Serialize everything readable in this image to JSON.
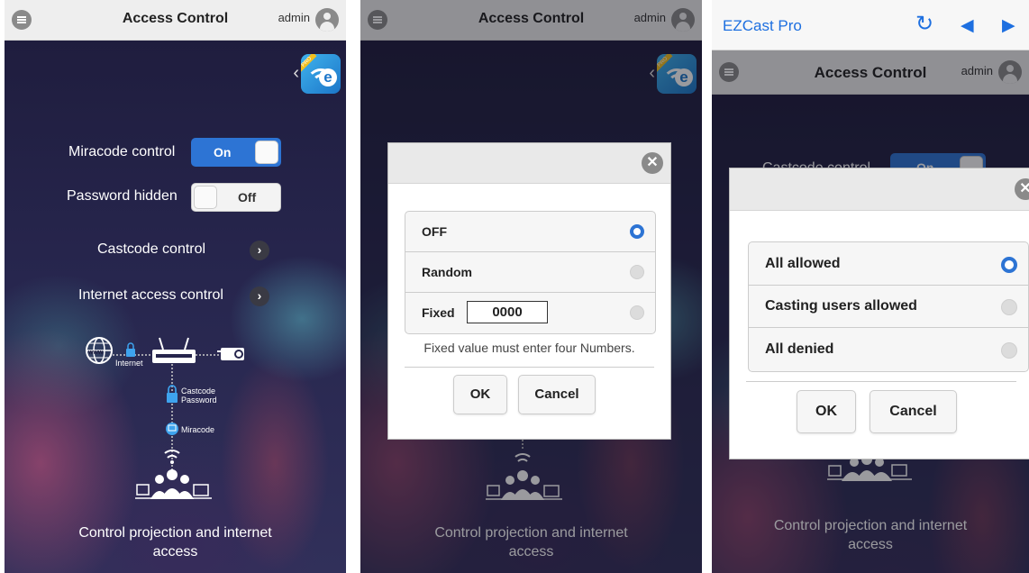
{
  "panel1": {
    "header": {
      "title": "Access Control",
      "user": "admin"
    },
    "miracode": {
      "label": "Miracode control",
      "state": "On"
    },
    "password": {
      "label": "Password hidden",
      "state": "Off"
    },
    "castcode": {
      "label": "Castcode control"
    },
    "internet": {
      "label": "Internet access control"
    },
    "diagram": {
      "www": "www",
      "internet": "Internet",
      "castcode": "Castcode",
      "password": "Password",
      "miracode": "Miracode"
    },
    "caption_line1": "Control projection and internet",
    "caption_line2": "access"
  },
  "panel2": {
    "header": {
      "title": "Access Control",
      "user": "admin"
    },
    "dialog": {
      "options": [
        {
          "label": "OFF",
          "selected": true
        },
        {
          "label": "Random",
          "selected": false
        },
        {
          "label": "Fixed",
          "selected": false
        }
      ],
      "fixed_value": "0000",
      "hint": "Fixed value must enter four Numbers.",
      "ok": "OK",
      "cancel": "Cancel"
    },
    "caption_line1": "Control projection and internet",
    "caption_line2": "access"
  },
  "panel3": {
    "browser": {
      "app_name": "EZCast Pro"
    },
    "header": {
      "title": "Access Control",
      "user": "admin"
    },
    "bg_label": "Castcode control",
    "bg_toggle": "On",
    "dialog": {
      "options": [
        {
          "label": "All allowed",
          "selected": true
        },
        {
          "label": "Casting users allowed",
          "selected": false
        },
        {
          "label": "All denied",
          "selected": false
        }
      ],
      "ok": "OK",
      "cancel": "Cancel"
    },
    "caption_line1": "Control projection and internet",
    "caption_line2": "access"
  },
  "colors": {
    "accent": "#2d74d4",
    "browser_blue": "#1d6fe0",
    "bg_dark": "#26254c"
  },
  "icons": [
    "menu-icon",
    "user-avatar-icon",
    "ezcast-logo-icon",
    "chevron-right-icon",
    "close-icon",
    "refresh-icon",
    "back-arrow-icon",
    "forward-arrow-icon",
    "globe-icon",
    "lock-icon",
    "router-icon",
    "projector-icon",
    "users-icon",
    "wifi-icon"
  ]
}
